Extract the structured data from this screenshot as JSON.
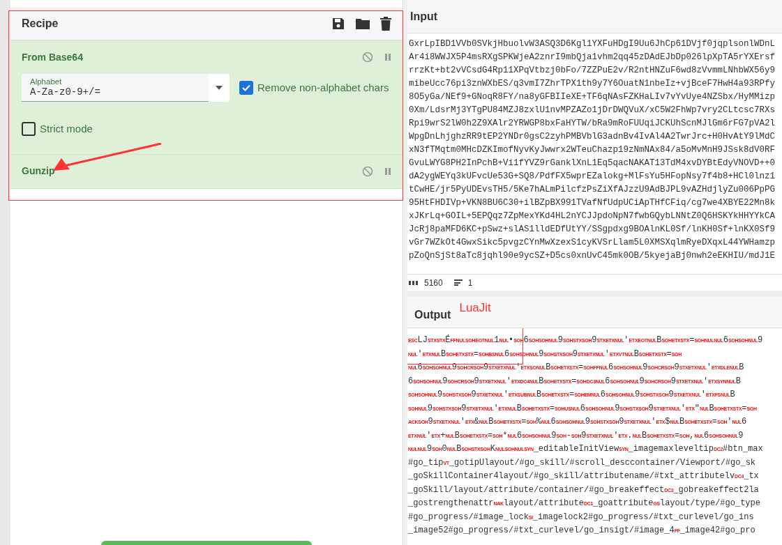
{
  "recipe": {
    "title": "Recipe",
    "operations": [
      {
        "name": "From Base64",
        "disabled": false,
        "paused": false,
        "alphabet": {
          "label": "Alphabet",
          "value": "A-Za-z0-9+/="
        },
        "options": [
          {
            "label": "Remove non-alphabet chars",
            "checked": true
          },
          {
            "label": "Strict mode",
            "checked": false
          }
        ]
      },
      {
        "name": "Gunzip",
        "disabled": false,
        "paused": false
      }
    ]
  },
  "input": {
    "title": "Input",
    "lines": [
      "GxrLpIBD1VVb0SVkjHbuolvW3ASQ3D6Kgl1YXFuHDgI9Uu6JhCp61DVjf0jqplsonlWDnL",
      "Ar4i8WWJX5P4msRXgSPKWjeA2znrI9mbQja1vhm2qq45zDAdEJbDp026lpXpTA5rYXErsf",
      "rrzKt+bt2vVCsdG4Rp11XPqVtbzj0bFo/7ZZPuE2v/R2ntHNZuF6wd8zVvmmLNhbWX56y9",
      "mibeUcc76pi3znWXbES/q3vmI7ZhrTPX1th9y7Y6OuatN1nbeIz+vjBceF7HwH4a93RPfy",
      "8O5yGa/NEf9+GNoqR8FY/na8yGFBIIeXE+TF6qNAsFZKHaLIv7vYvUye4NZSbx/HyMMizp",
      "0Xm/LdsrMj3YTgPU84MZJ8zxlU1nvMPZAZo1jDrDWQVuX/xC5W2FhWp7vry2CLtcsc7RXs",
      "Rpi9wrS2lW0h2Z9XAlr2YRWGP8bxFaHYTW/bRa9mRoFUUqiJCKUhScnMJlGm6rFG7pVA2l",
      "WpgDnLhjghzRR9tEP2YNDr0gsC2zyhPMBVblG3adnBv4IvAl4A2TwrJrc+H0HvAtY9lMdC",
      "xN3fTMqtm0MHcDZKImofNyvKyJwwrx2WTeuChazp19zNmNAx84/a5oMvMnH9JSsk8dV0RF",
      "GvuLWYG8PH2InPchB+Vi1fYVZ9rGanklXnL1Eq5qacNAKAT13TdM4xvDYBtEdyVNOVD++0",
      "dA2ygWEYq3kUFvcUe53G+SQ8/PdfFX5wprEZalokg+MlFsYu5HFopNsy7f4b8+HCl0lnz1",
      "tCwHE/jr5PyUDEvsTH5/5Ke7hALmPilcfzPsZiXfAJzzU9AdBJPL9vAZHdjlyZu006PpPG",
      "95HtFHDIVp+VKN8BU6C30+ilBZpBX991TVafNfUdpUCiApTHfCFiq/cg7we4XBYE22Mn8k",
      "xJKrLq+GOIL+5EPQqz7ZpMexYKd4HL2nYCJJpdoNpN7fwbGQybLNNtZ0Q6HSKYkHHYYkCA",
      "JcRj8paMFD6KC+pSwz+slAS1lldEDfUtYY/SSgpdxg9BOAlnKL0Sf/lnKH0Sf+lnKX0Sf9",
      "vGr7WZkOt4GwxSikc5pvgzCYnMwXzexS1cyKVSrLlam5L0XMSXqlmRyeDXqxL44YWHamzp",
      "pZoQnSjSt8aTc8jqhl90e9ycSZ+D5cs0xnUvC45mk0OB/5kyejaBj0nwh2eEKHIU/mdJ1E"
    ],
    "length": "5160",
    "line_count": "1"
  },
  "output": {
    "title": "Output",
    "annotation": "LuaJit",
    "lines": [
      [
        {
          "c": "ESC"
        },
        "LJ",
        {
          "c": "STX"
        },
        {
          "c": "STX"
        },
        "É",
        {
          "c": "FF"
        },
        {
          "c": "NUL"
        },
        {
          "c": "SOH"
        },
        {
          "c": "EOT"
        },
        {
          "c": "NUL"
        },
        "1",
        {
          "c": "NUL"
        },
        "•",
        {
          "c": "SOH"
        },
        "6",
        {
          "c": "SOH"
        },
        {
          "c": "SOH"
        },
        {
          "c": "NUL"
        },
        "9",
        {
          "c": "SOH"
        },
        {
          "c": "STX"
        },
        {
          "c": "SOH"
        },
        "9",
        {
          "c": "STX"
        },
        {
          "c": "ETX"
        },
        {
          "c": "NUL"
        },
        "'",
        {
          "c": "ETX"
        },
        {
          "c": "EOT"
        },
        {
          "c": "NUL"
        },
        "B",
        {
          "c": "SOH"
        },
        {
          "c": "ETX"
        },
        {
          "c": "STX"
        },
        "=",
        {
          "c": "SOH"
        },
        {
          "c": "NUL"
        },
        {
          "c": "NUL"
        },
        "6",
        {
          "c": "SOH"
        },
        {
          "c": "SOH"
        },
        {
          "c": "NUL"
        },
        "9"
      ],
      [
        {
          "c": "NUL"
        },
        "'",
        {
          "c": "ETX"
        },
        {
          "c": "NUL"
        },
        "B",
        {
          "c": "SOH"
        },
        {
          "c": "ETX"
        },
        {
          "c": "STX"
        },
        "=",
        {
          "c": "SOH"
        },
        {
          "c": "BS"
        },
        {
          "c": "NUL"
        },
        "6",
        {
          "c": "SOH"
        },
        {
          "c": "SOH"
        },
        {
          "c": "NUL"
        },
        "9",
        {
          "c": "SOH"
        },
        {
          "c": "STX"
        },
        {
          "c": "SOH"
        },
        "9",
        {
          "c": "STX"
        },
        {
          "c": "ETX"
        },
        {
          "c": "NUL"
        },
        "'",
        {
          "c": "ETX"
        },
        {
          "c": "VT"
        },
        {
          "c": "NUL"
        },
        "B",
        {
          "c": "SOH"
        },
        {
          "c": "ETX"
        },
        {
          "c": "STX"
        },
        "=",
        {
          "c": "SOH"
        }
      ],
      [
        {
          "c": "NUL"
        },
        "6",
        {
          "c": "SOH"
        },
        {
          "c": "SOH"
        },
        {
          "c": "NUL"
        },
        "9",
        {
          "c": "SOH"
        },
        {
          "c": "CR"
        },
        {
          "c": "SOH"
        },
        "9",
        {
          "c": "STX"
        },
        {
          "c": "ETX"
        },
        {
          "c": "NUL"
        },
        "'",
        {
          "c": "ETX"
        },
        {
          "c": "SO"
        },
        {
          "c": "NUL"
        },
        "B",
        {
          "c": "SOH"
        },
        {
          "c": "ETX"
        },
        {
          "c": "STX"
        },
        "=",
        {
          "c": "SOH"
        },
        {
          "c": "FF"
        },
        {
          "c": "NUL"
        },
        "6",
        {
          "c": "SOH"
        },
        {
          "c": "SOH"
        },
        {
          "c": "NUL"
        },
        "9",
        {
          "c": "SOH"
        },
        {
          "c": "CR"
        },
        {
          "c": "SOH"
        },
        "9",
        {
          "c": "STX"
        },
        {
          "c": "ETX"
        },
        {
          "c": "NUL"
        },
        "'",
        {
          "c": "ETX"
        },
        {
          "c": "DLE"
        },
        {
          "c": "NUL"
        },
        "B"
      ],
      [
        "6",
        {
          "c": "SOH"
        },
        {
          "c": "SOH"
        },
        {
          "c": "NUL"
        },
        "9",
        {
          "c": "SOH"
        },
        {
          "c": "CR"
        },
        {
          "c": "SOH"
        },
        "9",
        {
          "c": "STX"
        },
        {
          "c": "ETX"
        },
        {
          "c": "NUL"
        },
        "'",
        {
          "c": "ETX"
        },
        {
          "c": "DC4"
        },
        {
          "c": "NUL"
        },
        "B",
        {
          "c": "SOH"
        },
        {
          "c": "ETX"
        },
        {
          "c": "STX"
        },
        "=",
        {
          "c": "SOH"
        },
        {
          "c": "DC3"
        },
        {
          "c": "NUL"
        },
        "6",
        {
          "c": "SOH"
        },
        {
          "c": "SOH"
        },
        {
          "c": "NUL"
        },
        "9",
        {
          "c": "SOH"
        },
        {
          "c": "CR"
        },
        {
          "c": "SOH"
        },
        "9",
        {
          "c": "STX"
        },
        {
          "c": "ETX"
        },
        {
          "c": "NUL"
        },
        "'",
        {
          "c": "ETX"
        },
        {
          "c": "SYN"
        },
        {
          "c": "NUL"
        },
        "B"
      ],
      [
        {
          "c": "SOH"
        },
        {
          "c": "SOH"
        },
        {
          "c": "NUL"
        },
        "9",
        {
          "c": "SOH"
        },
        {
          "c": "STX"
        },
        {
          "c": "SOH"
        },
        "9",
        {
          "c": "STX"
        },
        {
          "c": "ETX"
        },
        {
          "c": "NUL"
        },
        "'",
        {
          "c": "ETX"
        },
        {
          "c": "SUB"
        },
        {
          "c": "NUL"
        },
        "B",
        {
          "c": "SOH"
        },
        {
          "c": "ETX"
        },
        {
          "c": "STX"
        },
        "=",
        {
          "c": "SOH"
        },
        {
          "c": "EM"
        },
        {
          "c": "NUL"
        },
        "6",
        {
          "c": "SOH"
        },
        {
          "c": "SOH"
        },
        {
          "c": "NUL"
        },
        "9",
        {
          "c": "SOH"
        },
        {
          "c": "STX"
        },
        {
          "c": "SOH"
        },
        "9",
        {
          "c": "STX"
        },
        {
          "c": "ETX"
        },
        {
          "c": "NUL"
        },
        "'",
        {
          "c": "ETX"
        },
        {
          "c": "FS"
        },
        {
          "c": "NUL"
        },
        "B"
      ],
      [
        {
          "c": "SOH"
        },
        {
          "c": "NUL"
        },
        "9",
        {
          "c": "SOH"
        },
        {
          "c": "STX"
        },
        {
          "c": "SOH"
        },
        "9",
        {
          "c": "STX"
        },
        {
          "c": "ETX"
        },
        {
          "c": "NUL"
        },
        "'",
        {
          "c": "ETX"
        },
        {
          "c": "NUL"
        },
        "B",
        {
          "c": "SOH"
        },
        {
          "c": "ETX"
        },
        {
          "c": "STX"
        },
        "=",
        {
          "c": "SOH"
        },
        {
          "c": "US"
        },
        {
          "c": "NUL"
        },
        "6",
        {
          "c": "SOH"
        },
        {
          "c": "SOH"
        },
        {
          "c": "NUL"
        },
        "9",
        {
          "c": "SOH"
        },
        {
          "c": "STX"
        },
        {
          "c": "SOH"
        },
        "9",
        {
          "c": "STX"
        },
        {
          "c": "ETX"
        },
        {
          "c": "NUL"
        },
        "'",
        {
          "c": "ETX"
        },
        "\"",
        {
          "c": "NUL"
        },
        "B",
        {
          "c": "SOH"
        },
        {
          "c": "ETX"
        },
        {
          "c": "STX"
        },
        "=",
        {
          "c": "SOH"
        }
      ],
      [
        {
          "c": "ACK"
        },
        {
          "c": "SOH"
        },
        "9",
        {
          "c": "STX"
        },
        {
          "c": "ETX"
        },
        {
          "c": "NUL"
        },
        "'",
        {
          "c": "ETX"
        },
        "&",
        {
          "c": "NUL"
        },
        "B",
        {
          "c": "SOH"
        },
        {
          "c": "ETX"
        },
        {
          "c": "STX"
        },
        "=",
        {
          "c": "SOH"
        },
        "%",
        {
          "c": "NUL"
        },
        "6",
        {
          "c": "SOH"
        },
        {
          "c": "SOH"
        },
        {
          "c": "NUL"
        },
        "9",
        {
          "c": "SOH"
        },
        {
          "c": "STX"
        },
        {
          "c": "SOH"
        },
        "9",
        {
          "c": "STX"
        },
        {
          "c": "ETX"
        },
        {
          "c": "NUL"
        },
        "'",
        {
          "c": "ETX"
        },
        "$",
        {
          "c": "NUL"
        },
        "B",
        {
          "c": "SOH"
        },
        {
          "c": "ETX"
        },
        {
          "c": "STX"
        },
        "=",
        {
          "c": "SOH"
        },
        "'",
        {
          "c": "NUL"
        },
        "6"
      ],
      [
        {
          "c": "ETX"
        },
        {
          "c": "NUL"
        },
        "'",
        {
          "c": "ETX"
        },
        "+",
        {
          "c": "NUL"
        },
        "B",
        {
          "c": "SOH"
        },
        {
          "c": "ETX"
        },
        {
          "c": "STX"
        },
        "=",
        {
          "c": "SOH"
        },
        "*",
        {
          "c": "NUL"
        },
        "6",
        {
          "c": "SOH"
        },
        {
          "c": "SOH"
        },
        {
          "c": "NUL"
        },
        "9",
        {
          "c": "SOH"
        },
        "-",
        {
          "c": "SOH"
        },
        "9",
        {
          "c": "STX"
        },
        {
          "c": "ETX"
        },
        {
          "c": "NUL"
        },
        "'",
        {
          "c": "ETX"
        },
        ".",
        {
          "c": "NUL"
        },
        "B",
        {
          "c": "SOH"
        },
        {
          "c": "ETX"
        },
        {
          "c": "STX"
        },
        "=",
        {
          "c": "SOH"
        },
        ",",
        {
          "c": "NUL"
        },
        "6",
        {
          "c": "SOH"
        },
        {
          "c": "SOH"
        },
        {
          "c": "NUL"
        },
        "9"
      ],
      [
        {
          "c": "NUL"
        },
        {
          "c": "NUL"
        },
        "9",
        {
          "c": "SOH"
        },
        "0",
        {
          "c": "NUL"
        },
        "B",
        {
          "c": "SOH"
        },
        {
          "c": "STX"
        },
        {
          "c": "SOH"
        },
        "K",
        {
          "c": "NUL"
        },
        {
          "c": "SOH"
        },
        {
          "c": "NUL"
        },
        {
          "c": "SYN"
        },
        "_editableInitView",
        {
          "c": "SYN"
        },
        "_imagemaxleveltip",
        {
          "c": "DC2"
        },
        "#btn_max"
      ],
      [
        "#go_tip",
        {
          "c": "VT"
        },
        "_gotipUlayout/#go_skill/#scroll_desccontainer/Viewport/#go_sk"
      ],
      [
        "_goSkillContainer4layout/#go_skill/attributename/#txt_attributelv",
        {
          "c": "DC4"
        },
        "_tx"
      ],
      [
        "_goSkill/layout/attribute/container/#go_breakeffect",
        {
          "c": "DC3"
        },
        "_gobreakeffect2la"
      ],
      [
        "_gostrengthenattr",
        {
          "c": "NAK"
        },
        "layout/attribute",
        {
          "c": "DC1"
        },
        "_goattribute",
        {
          "c": "GS"
        },
        "layout/type/#go_type"
      ],
      [
        "#go_progress/#image_lock",
        {
          "c": "SI"
        },
        "_imagelock2#go_progress/#txt_curlevel/go_ins"
      ],
      [
        "_image52#go_progress/#txt_curlevel/go_insigt/#image_4",
        {
          "c": "FF"
        },
        "_image42#go_pro"
      ]
    ]
  }
}
